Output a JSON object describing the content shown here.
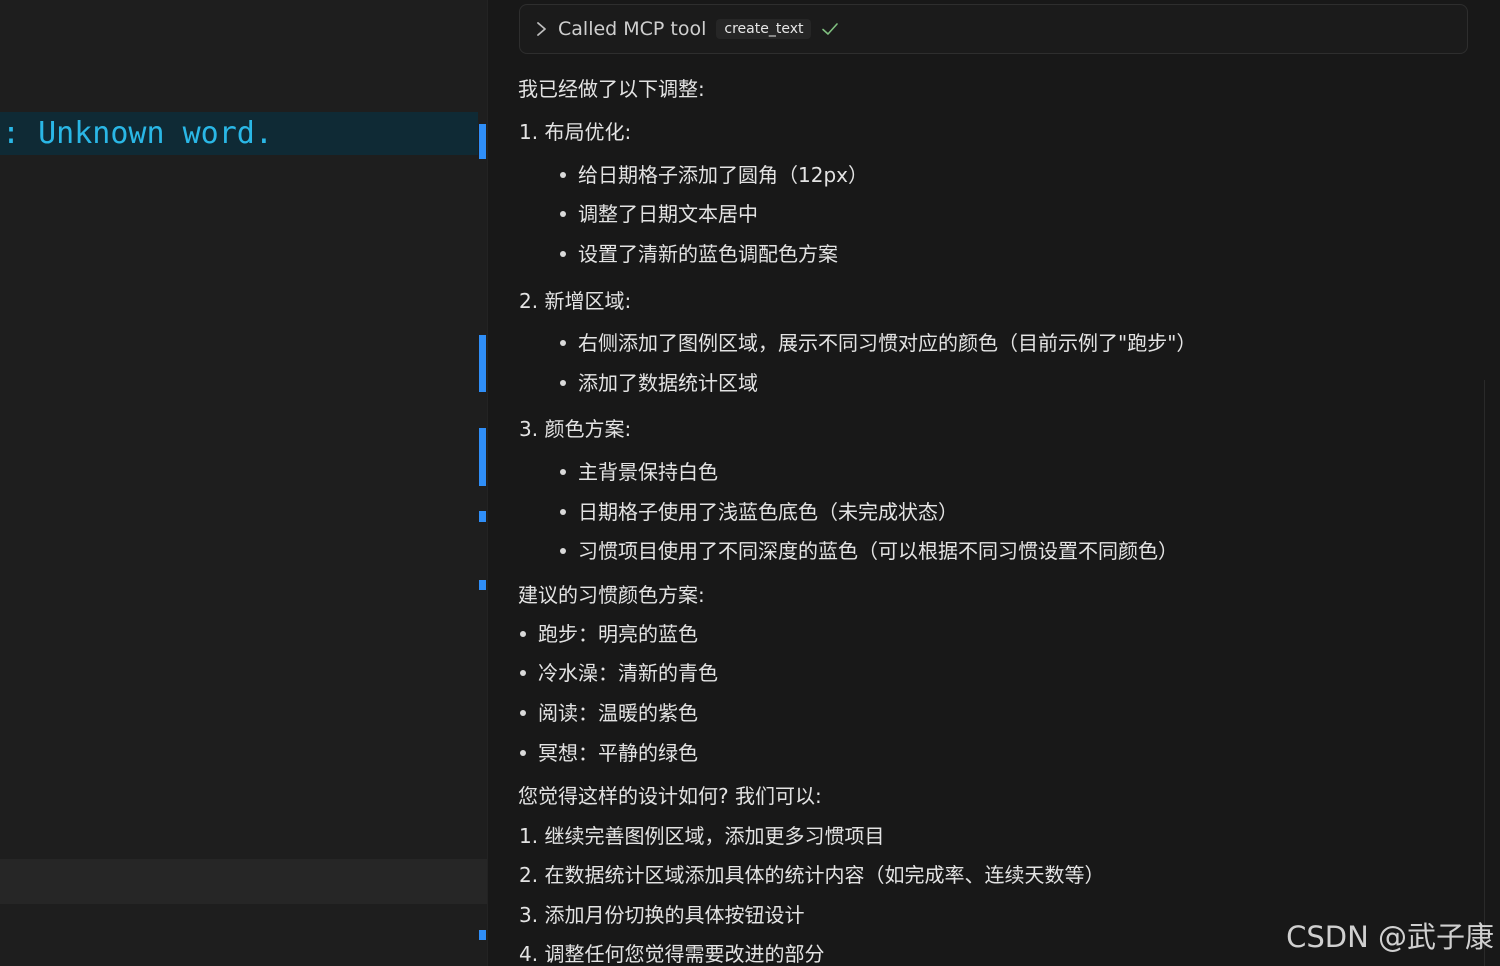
{
  "editor": {
    "diagnostic_text": ": Unknown word."
  },
  "tool_call": {
    "label": "Called MCP tool",
    "tool_name": "create_text",
    "status_icon": "check-icon",
    "expand_icon": "chevron-right-icon"
  },
  "message": {
    "intro": "我已经做了以下调整:",
    "section1": {
      "title": "1. 布局优化:",
      "items": [
        "给日期格子添加了圆角（12px）",
        "调整了日期文本居中",
        "设置了清新的蓝色调配色方案"
      ]
    },
    "section2": {
      "title": "2. 新增区域:",
      "items": [
        "右侧添加了图例区域，展示不同习惯对应的颜色（目前示例了\"跑步\"）",
        "添加了数据统计区域"
      ]
    },
    "section3": {
      "title": "3. 颜色方案:",
      "items": [
        "主背景保持白色",
        "日期格子使用了浅蓝色底色（未完成状态）",
        "习惯项目使用了不同深度的蓝色（可以根据不同习惯设置不同颜色）"
      ]
    },
    "suggest_title": "建议的习惯颜色方案:",
    "suggest_items": [
      "跑步：明亮的蓝色",
      "冷水澡：清新的青色",
      "阅读：温暖的紫色",
      "冥想：平静的绿色"
    ],
    "question": "您觉得这样的设计如何? 我们可以:",
    "options": [
      "1. 继续完善图例区域，添加更多习惯项目",
      "2. 在数据统计区域添加具体的统计内容（如完成率、连续天数等）",
      "3. 添加月份切换的具体按钮设计",
      "4. 调整任何您觉得需要改进的部分"
    ]
  },
  "watermark": "CSDN @武子康",
  "colors": {
    "diagnostic_text": "#2ab7e6",
    "gutter_marker": "#2f8ef7",
    "check": "#7fbf7f"
  }
}
